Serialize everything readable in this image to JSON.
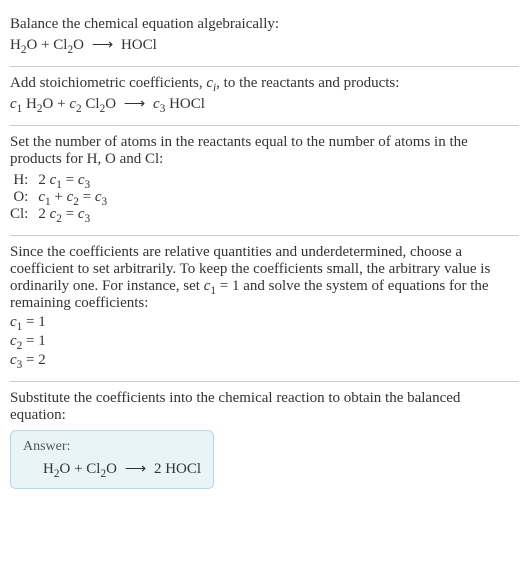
{
  "section1": {
    "title": "Balance the chemical equation algebraically:",
    "eq_h2o": "H",
    "eq_h2o_sub": "2",
    "eq_h2o_end": "O",
    "plus1": " + ",
    "eq_cl2o": "Cl",
    "eq_cl2o_sub": "2",
    "eq_cl2o_end": "O",
    "arrow": " ⟶ ",
    "eq_hocl": "HOCl"
  },
  "section2": {
    "title_part1": "Add stoichiometric coefficients, ",
    "title_ci": "c",
    "title_ci_sub": "i",
    "title_part2": ", to the reactants and products:",
    "c1": "c",
    "c1_sub": "1",
    "sp1": " ",
    "h2o_h": "H",
    "h2o_sub": "2",
    "h2o_o": "O",
    "plus": " + ",
    "c2": "c",
    "c2_sub": "2",
    "sp2": " ",
    "cl2o_cl": "Cl",
    "cl2o_sub": "2",
    "cl2o_o": "O",
    "arrow": " ⟶ ",
    "c3": "c",
    "c3_sub": "3",
    "sp3": " ",
    "hocl": "HOCl"
  },
  "section3": {
    "title": "Set the number of atoms in the reactants equal to the number of atoms in the products for H, O and Cl:",
    "rows": [
      {
        "el": "H:",
        "eq_a": "2 ",
        "eq_c1": "c",
        "eq_c1s": "1",
        "eq_mid": " = ",
        "eq_c2": "c",
        "eq_c2s": "3"
      },
      {
        "el": "O:",
        "eq_a": "",
        "eq_c1": "c",
        "eq_c1s": "1",
        "eq_mid": " + ",
        "eq_cm": "c",
        "eq_cms": "2",
        "eq_mid2": " = ",
        "eq_c2": "c",
        "eq_c2s": "3"
      },
      {
        "el": "Cl:",
        "eq_a": "2 ",
        "eq_c1": "c",
        "eq_c1s": "2",
        "eq_mid": " = ",
        "eq_c2": "c",
        "eq_c2s": "3"
      }
    ]
  },
  "section4": {
    "title_part1": "Since the coefficients are relative quantities and underdetermined, choose a coefficient to set arbitrarily. To keep the coefficients small, the arbitrary value is ordinarily one. For instance, set ",
    "title_c1": "c",
    "title_c1_sub": "1",
    "title_part2": " = 1 and solve the system of equations for the remaining coefficients:",
    "lines": [
      {
        "c": "c",
        "cs": "1",
        "val": " = 1"
      },
      {
        "c": "c",
        "cs": "2",
        "val": " = 1"
      },
      {
        "c": "c",
        "cs": "3",
        "val": " = 2"
      }
    ]
  },
  "section5": {
    "title": "Substitute the coefficients into the chemical reaction to obtain the balanced equation:",
    "answer_label": "Answer:",
    "eq_h2o": "H",
    "eq_h2o_sub": "2",
    "eq_h2o_end": "O",
    "plus1": " + ",
    "eq_cl2o": "Cl",
    "eq_cl2o_sub": "2",
    "eq_cl2o_end": "O",
    "arrow": " ⟶ ",
    "coef": "2 ",
    "eq_hocl": "HOCl"
  }
}
